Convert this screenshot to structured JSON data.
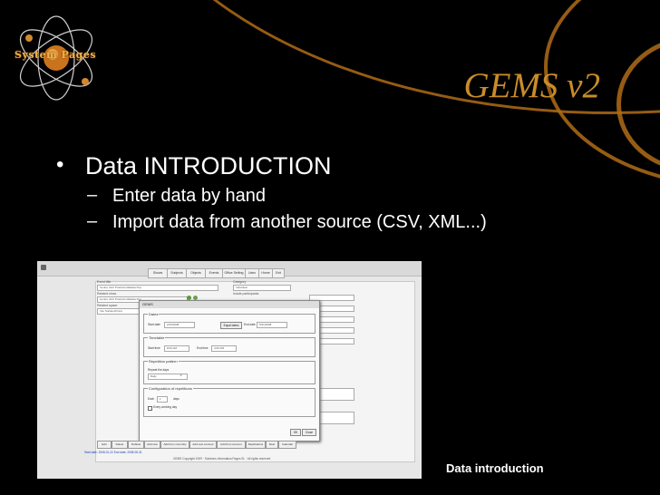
{
  "logo_text": "System Pages",
  "slide_title": "GEMS v2",
  "bullets": {
    "main": "Data INTRODUCTION",
    "sub": [
      "Enter data by hand",
      "Import data from another source (CSV, XML...)"
    ]
  },
  "screenshot": {
    "nav_tabs": [
      "Shows",
      "Subjects",
      "Objects",
      "Events",
      "Office Setting",
      "Uses",
      "Home",
      "Exit"
    ],
    "left_fields": [
      {
        "label": "Event title",
        "value": "Centre d'Art Products Malaisa Pop"
      },
      {
        "label": "Related show",
        "value": "Centre d'Art Products Malaisa Pop"
      },
      {
        "label": "Related space",
        "value": "Into Surfaa Afrinca"
      }
    ],
    "right_fields": [
      {
        "label": "Category",
        "value": "Individual"
      },
      {
        "label": "Inlude participants",
        "value": ""
      }
    ],
    "dialog": {
      "title": "GEMS",
      "dates": {
        "legend": "Dates",
        "start_label": "Start date",
        "start_value": "2/23/2008",
        "equal_button": "Equal dates",
        "end_label": "End date",
        "end_value": "5/31/2008"
      },
      "timetable": {
        "legend": "Timetable",
        "start_label": "Start time",
        "start_value": "8:00 AM",
        "end_label": "End time",
        "end_value": "4:00 PM"
      },
      "repetition": {
        "legend": "Repetition pattern",
        "repeat_label": "Repeat the days",
        "repeat_value": "Daily"
      },
      "config": {
        "legend": "Configuration of repetitions",
        "each_label": "Each",
        "each_value": "1",
        "days_label": "days",
        "working_label": "Every working day"
      },
      "ok": "OK",
      "close": "Close"
    },
    "bottom_tabs": [
      "Edit",
      "Delete",
      "Dublets",
      "Add new",
      "Add from comunity",
      "Add new concour",
      "Add from concour",
      "Replications",
      "Rest",
      "Calendar"
    ],
    "status_left": "Start date: 2008-01-22  End date: 2008-05-31",
    "footer": "GEMS   Copyright 2009 · Solutions Informatica Pages SL · All rights reserved"
  },
  "caption": "Data introduction"
}
